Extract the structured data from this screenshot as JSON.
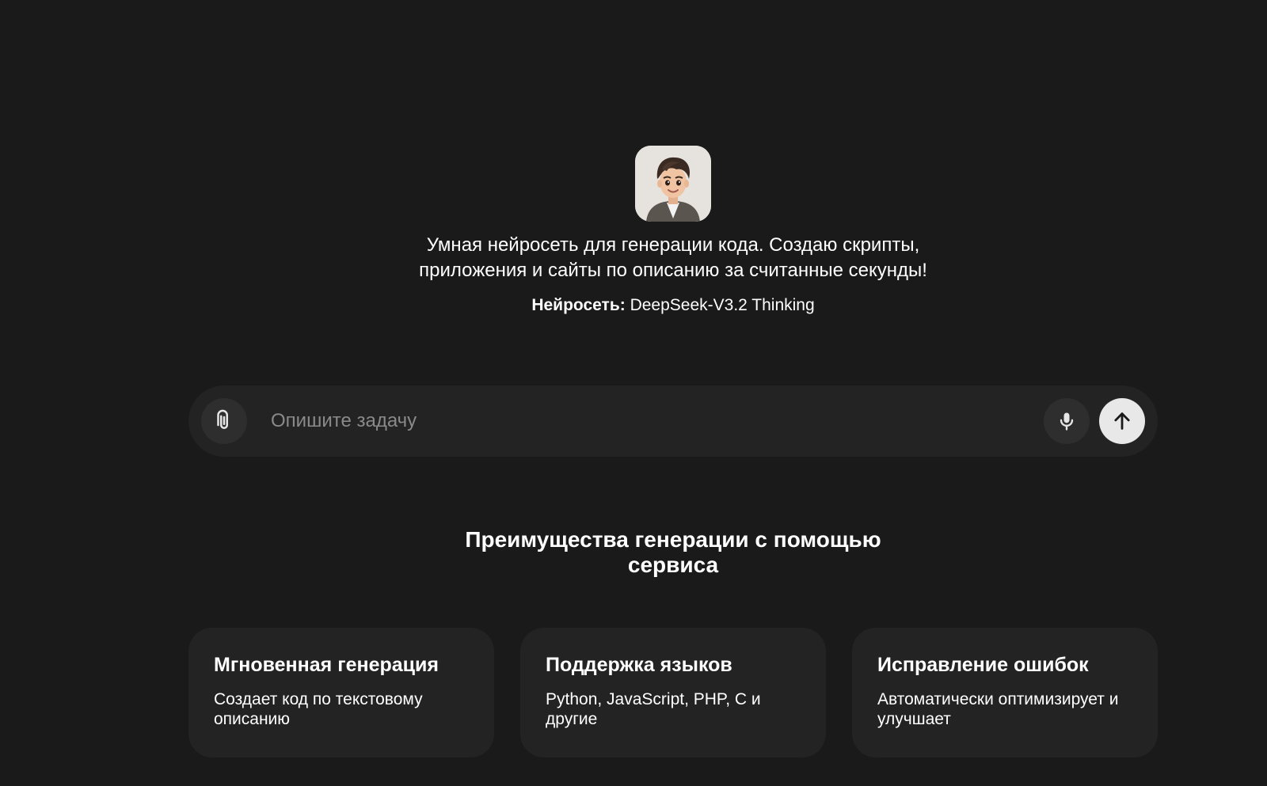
{
  "hero": {
    "avatar_icon": "cartoon-boy-avatar-icon",
    "tagline_line1": "Умная нейросеть для генерации кода. Создаю скрипты,",
    "tagline_line2": "приложения и сайты по описанию за считанные секунды!",
    "model_label": "Нейросеть:",
    "model_value": " DeepSeek-V3.2 Thinking"
  },
  "composer": {
    "placeholder": "Опишите задачу",
    "value": "",
    "attach_icon": "paperclip-icon",
    "mic_icon": "microphone-icon",
    "send_icon": "arrow-up-icon"
  },
  "features": {
    "title_line1": "Преимущества генерации с помощью",
    "title_line2": "сервиса",
    "cards": [
      {
        "title": "Мгновенная генерация",
        "description": "Создает код по текстовому описанию"
      },
      {
        "title": "Поддержка языков",
        "description": "Python, JavaScript, PHP, C и другие"
      },
      {
        "title": "Исправление ошибок",
        "description": "Автоматически оптимизирует и улучшает"
      }
    ]
  },
  "colors": {
    "background": "#1a1a1a",
    "surface": "#232323",
    "button_bg": "#2e2e2e",
    "send_bg": "#e8e8e8",
    "text": "#ffffff",
    "placeholder": "#8a8a8a"
  }
}
